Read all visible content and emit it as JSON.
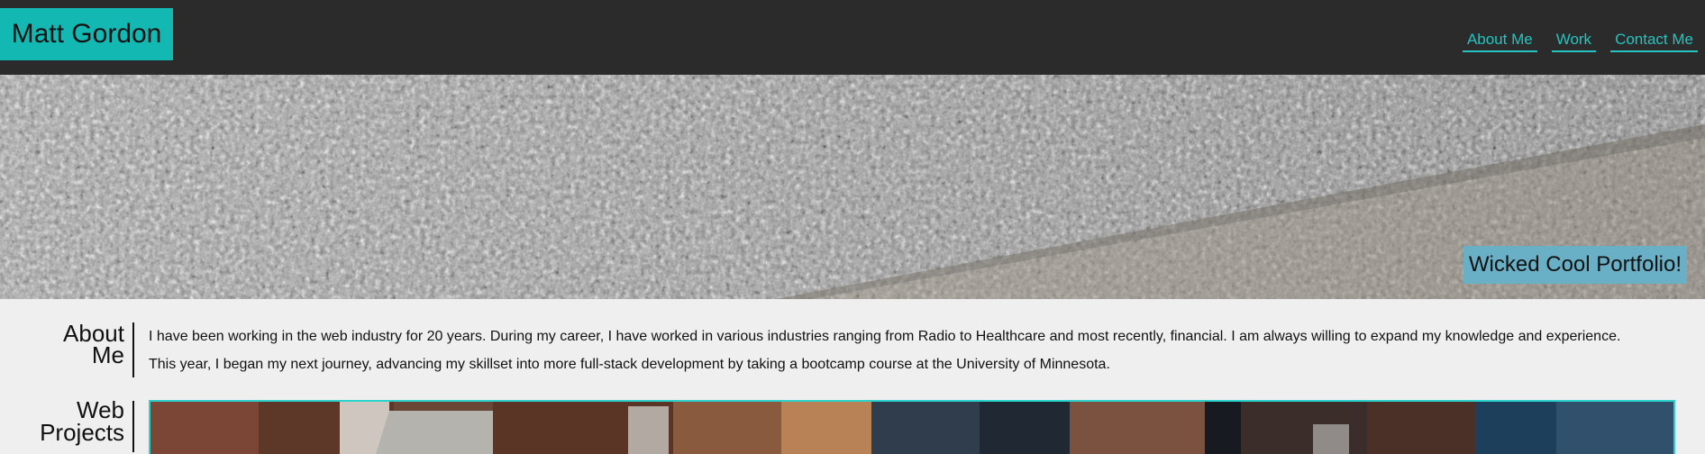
{
  "header": {
    "brand": "Matt Gordon",
    "nav": [
      {
        "label": "About Me"
      },
      {
        "label": "Work"
      },
      {
        "label": "Contact Me"
      }
    ]
  },
  "hero": {
    "badge": "Wicked Cool Portfolio!"
  },
  "about": {
    "title": "About Me",
    "paragraphs": [
      "I have been working in the web industry for 20 years. During my career, I have worked in various industries ranging from Radio to Healthcare and most recently, financial. I am always willing to expand my knowledge and experience.",
      "This year, I began my next journey, advancing my skillset into more full-stack development by taking a bootcamp course at the University of Minnesota."
    ]
  },
  "projects": {
    "title": "Web Projects"
  },
  "colors": {
    "header_bg": "#2b2b2b",
    "brand_bg": "#14b8b3",
    "nav_link": "#24c4c0",
    "badge_bg": "#69afc6",
    "page_bg": "#efefef"
  }
}
